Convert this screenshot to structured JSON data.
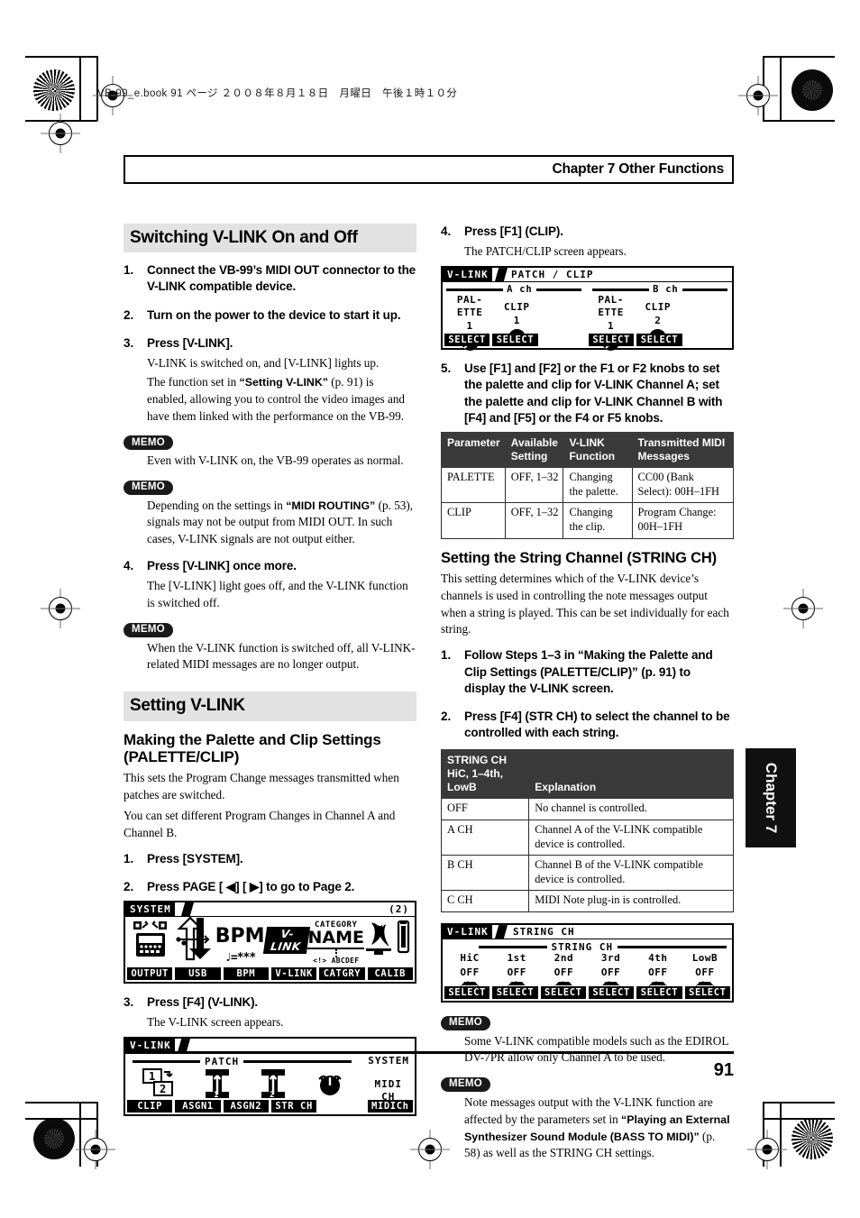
{
  "print_marks": {
    "file_stamp": "VB-99_e.book  91 ページ  ２００８年８月１８日　月曜日　午後１時１０分"
  },
  "header": {
    "chapter_title": "Chapter 7 Other Functions"
  },
  "footer": {
    "page_number": "91"
  },
  "chapter_tab": {
    "label": "Chapter 7"
  },
  "left_column": {
    "section_title": "Switching V-LINK On and Off",
    "steps": [
      {
        "num": "1.",
        "text": "Connect the VB-99’s MIDI OUT connector to the V-LINK compatible device."
      },
      {
        "num": "2.",
        "text": "Turn on the power to the device to start it up."
      },
      {
        "num": "3.",
        "text": "Press [V-LINK]."
      }
    ],
    "step3_body_1": "V-LINK is switched on, and [V-LINK] lights up.",
    "step3_body_2_a": "The function set in ",
    "step3_body_2_b": "“Setting V-LINK”",
    "step3_body_2_c": " (p. 91) is enabled, allowing you to control the video images and have them linked with the performance on the VB-99.",
    "memo_badge": "MEMO",
    "memo_1": "Even with V-LINK on, the VB-99 operates as normal.",
    "memo_2_a": "Depending on the settings in ",
    "memo_2_b": "“MIDI ROUTING”",
    "memo_2_c": " (p. 53), signals may not be output from MIDI OUT. In such cases, V-LINK signals are not output either.",
    "step4": {
      "num": "4.",
      "text": "Press [V-LINK] once more."
    },
    "step4_body": "The [V-LINK] light goes off, and the V-LINK function is switched off.",
    "memo_3": "When the V-LINK function is switched off, all V-LINK-related MIDI messages are no longer output.",
    "section_title_2": "Setting V-LINK",
    "subsection_title": "Making the Palette and Clip Settings (PALETTE/CLIP)",
    "intro_1": "This sets the Program Change messages transmitted when patches are switched.",
    "intro_2": "You can set different Program Changes in Channel A and Channel B.",
    "steps_b": [
      {
        "num": "1.",
        "text": "Press [SYSTEM]."
      },
      {
        "num": "2.",
        "text": "Press PAGE [ ◀] [ ▶] to go to Page 2."
      },
      {
        "num": "3.",
        "text": "Press [F4] (V-LINK)."
      }
    ],
    "step3b_body": "The V-LINK screen appears."
  },
  "lcd_system": {
    "title": "SYSTEM",
    "page_indicator": "2",
    "icons": [
      {
        "name": "output-routing-icon",
        "caption": "OUTPUT"
      },
      {
        "name": "usb-transfer-icon",
        "caption": "USB"
      },
      {
        "name": "bpm-icon",
        "caption": "BPM",
        "big": "BPM",
        "sub": "♩=***"
      },
      {
        "name": "v-link-icon",
        "caption": "V-LINK",
        "big": "V-LINK"
      },
      {
        "name": "category-name-icon",
        "caption": "CATGRY",
        "top": "CATEGORY",
        "big": "NAME",
        "sub": "<!> ABCDEF"
      },
      {
        "name": "calibration-icon",
        "caption": "CALIB"
      }
    ],
    "soft_keys": [
      "OUTPUT",
      "USB",
      "BPM",
      "V-LINK",
      "CATGRY",
      "CALIB"
    ]
  },
  "lcd_vlink": {
    "title": "V-LINK",
    "section_label": "PATCH",
    "right_label_1": "SYSTEM",
    "right_label_2a": "MIDI",
    "right_label_2b": "CH",
    "icons": [
      {
        "name": "clip-layers-icon",
        "label_1": "1",
        "label_2": "2"
      },
      {
        "name": "assign1-icon",
        "label": "1"
      },
      {
        "name": "assign2-icon",
        "label": "2"
      },
      {
        "name": "string-ch-knob-icon",
        "label": ""
      }
    ],
    "soft_keys": [
      "CLIP",
      "ASGN1",
      "ASGN2",
      "STR CH",
      "",
      "MIDICh"
    ]
  },
  "right_column": {
    "step4": {
      "num": "4.",
      "text": "Press [F1] (CLIP)."
    },
    "step4_body": "The PATCH/CLIP screen appears.",
    "step5": {
      "num": "5.",
      "text": "Use [F1] and [F2] or the F1 or F2 knobs to set the palette and clip for V-LINK Channel A; set the palette and clip for V-LINK Channel B with [F4] and [F5] or the F4 or F5 knobs."
    },
    "table_palette": {
      "headers": [
        "Parameter",
        "Available Setting",
        "V-LINK Function",
        "Transmitted MIDI Messages"
      ],
      "rows": [
        [
          "PALETTE",
          "OFF, 1–32",
          "Changing the palette.",
          "CC00 (Bank Select): 00H–1FH"
        ],
        [
          "CLIP",
          "OFF, 1–32",
          "Changing the clip.",
          "Program Change: 00H–1FH"
        ]
      ]
    },
    "subsection_title": "Setting the String Channel (STRING CH)",
    "intro": "This setting determines which of the V-LINK device’s channels is used in controlling the note messages output when a string is played. This can be set individually for each string.",
    "steps": [
      {
        "num": "1.",
        "text": "Follow Steps 1–3 in “Making the Palette and Clip Settings (PALETTE/CLIP)” (p. 91) to display the V-LINK screen."
      },
      {
        "num": "2.",
        "text": "Press [F4] (STR CH) to select the channel to be controlled with each string."
      }
    ],
    "table_stringch": {
      "headers": [
        "STRING CH HiC, 1–4th, LowB",
        "Explanation"
      ],
      "rows": [
        [
          "OFF",
          "No channel is controlled."
        ],
        [
          "A CH",
          "Channel A of the V-LINK compatible device is controlled."
        ],
        [
          "B CH",
          "Channel B of the V-LINK compatible device is controlled."
        ],
        [
          "C CH",
          "MIDI Note plug-in is controlled."
        ]
      ]
    },
    "memo_badge": "MEMO",
    "memo_1": "Some V-LINK compatible models such as the EDIROL DV-7PR allow only Channel A to be used.",
    "memo_2_a": "Note messages output with the V-LINK function are affected by the parameters set in ",
    "memo_2_b": "“Playing an External Synthesizer Sound Module (BASS TO MIDI)”",
    "memo_2_c": " (p. 58) as well as the STRING CH settings."
  },
  "lcd_patchclip": {
    "title": "V-LINK",
    "breadcrumb_1": "PATCH",
    "breadcrumb_2": "CLIP",
    "channels": [
      {
        "ch_label": "A ch",
        "params": [
          {
            "name": "PAL-ETTE",
            "value": "1"
          },
          {
            "name": "CLIP",
            "value": "1"
          }
        ]
      },
      {
        "ch_label": "B ch",
        "params": [
          {
            "name": "PAL-ETTE",
            "value": "1"
          },
          {
            "name": "CLIP",
            "value": "2"
          }
        ]
      }
    ],
    "soft_keys": [
      "SELECT",
      "SELECT",
      "",
      "SELECT",
      "SELECT",
      ""
    ]
  },
  "lcd_stringch": {
    "title": "V-LINK",
    "breadcrumb": "STRING CH",
    "section_label": "STRING CH",
    "columns": [
      {
        "label": "HiC",
        "value": "OFF"
      },
      {
        "label": "1st",
        "value": "OFF"
      },
      {
        "label": "2nd",
        "value": "OFF"
      },
      {
        "label": "3rd",
        "value": "OFF"
      },
      {
        "label": "4th",
        "value": "OFF"
      },
      {
        "label": "LowB",
        "value": "OFF"
      }
    ],
    "soft_keys": [
      "SELECT",
      "SELECT",
      "SELECT",
      "SELECT",
      "SELECT",
      "SELECT"
    ]
  }
}
